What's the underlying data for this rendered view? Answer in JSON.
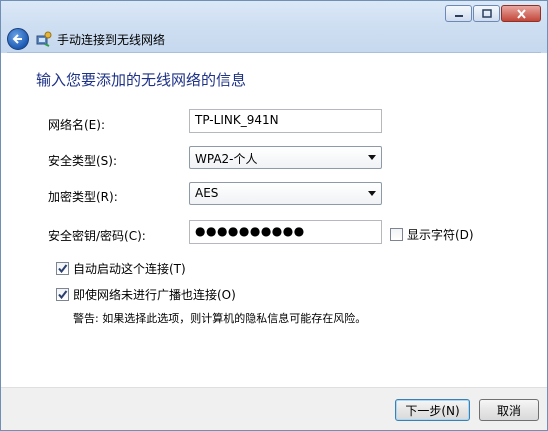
{
  "window": {
    "title": "手动连接到无线网络",
    "icon": "network-wizard-icon"
  },
  "heading": "输入您要添加的无线网络的信息",
  "form": {
    "network_name": {
      "label": "网络名(E):",
      "value": "TP-LINK_941N"
    },
    "security_type": {
      "label": "安全类型(S):",
      "value": "WPA2-个人"
    },
    "encryption_type": {
      "label": "加密类型(R):",
      "value": "AES"
    },
    "security_key": {
      "label": "安全密钥/密码(C):",
      "value": "●●●●●●●●●●",
      "show_chars_label": "显示字符(D)",
      "show_chars_checked": false
    }
  },
  "options": {
    "auto_connect": {
      "label": "自动启动这个连接(T)",
      "checked": true
    },
    "connect_hidden": {
      "label": "即使网络未进行广播也连接(O)",
      "checked": true
    }
  },
  "warning": "警告: 如果选择此选项，则计算机的隐私信息可能存在风险。",
  "buttons": {
    "next": "下一步(N)",
    "cancel": "取消"
  },
  "colors": {
    "heading": "#1e3287",
    "titlebar": "#cfdff2",
    "close_button": "#c2463a"
  }
}
